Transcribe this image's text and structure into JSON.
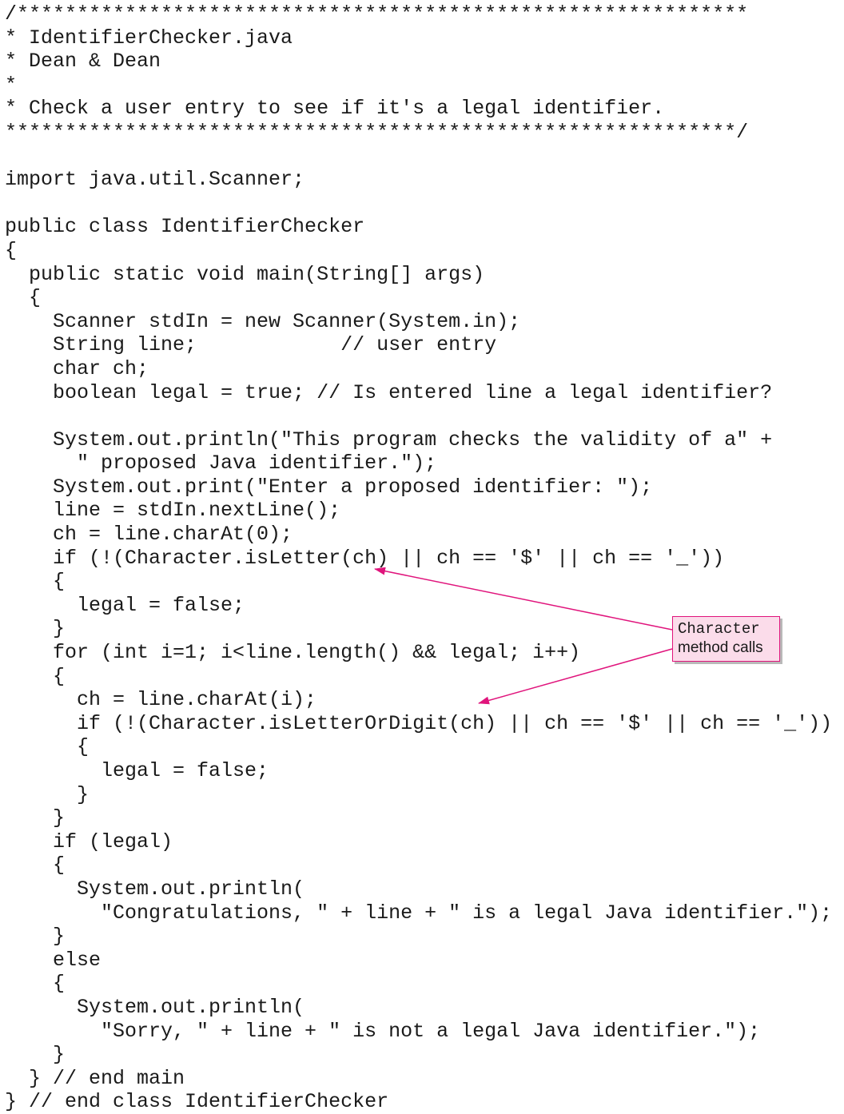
{
  "code_lines": [
    "/*************************************************************",
    "* IdentifierChecker.java",
    "* Dean & Dean",
    "*",
    "* Check a user entry to see if it's a legal identifier.",
    "*************************************************************/",
    "",
    "import java.util.Scanner;",
    "",
    "public class IdentifierChecker",
    "{",
    "  public static void main(String[] args)",
    "  {",
    "    Scanner stdIn = new Scanner(System.in);",
    "    String line;            // user entry",
    "    char ch;",
    "    boolean legal = true; // Is entered line a legal identifier?",
    "",
    "    System.out.println(\"This program checks the validity of a\" +",
    "      \" proposed Java identifier.\");",
    "    System.out.print(\"Enter a proposed identifier: \");",
    "    line = stdIn.nextLine();",
    "    ch = line.charAt(0);",
    "    if (!(Character.isLetter(ch) || ch == '$' || ch == '_'))",
    "    {",
    "      legal = false;",
    "    }",
    "    for (int i=1; i<line.length() && legal; i++)",
    "    {",
    "      ch = line.charAt(i);",
    "      if (!(Character.isLetterOrDigit(ch) || ch == '$' || ch == '_'))",
    "      {",
    "        legal = false;",
    "      }",
    "    }",
    "    if (legal)",
    "    {",
    "      System.out.println(",
    "        \"Congratulations, \" + line + \" is a legal Java identifier.\");",
    "    }",
    "    else",
    "    {",
    "      System.out.println(",
    "        \"Sorry, \" + line + \" is not a legal Java identifier.\");",
    "    }",
    "  } // end main",
    "} // end class IdentifierChecker"
  ],
  "callout": {
    "line1": "Character",
    "line2": "method calls"
  },
  "colors": {
    "accent": "#e0147c",
    "callout_fill": "#fbdcea",
    "text": "#1a1a1a"
  }
}
